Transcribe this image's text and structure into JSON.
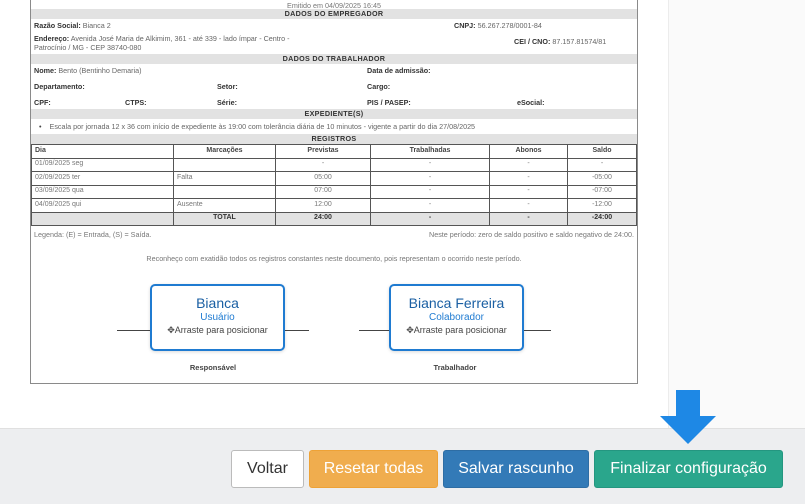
{
  "document": {
    "emitted": "Emitido em 04/09/2025 16:45",
    "sections": {
      "employer": "DADOS DO EMPREGADOR",
      "worker": "DADOS DO TRABALHADOR",
      "schedule": "EXPEDIENTE(S)",
      "records": "REGISTROS"
    },
    "employer": {
      "razao_label": "Razão Social:",
      "razao_value": "Bianca 2",
      "cnpj_label": "CNPJ:",
      "cnpj_value": "56.267.278/0001-84",
      "endereco_label": "Endereço:",
      "endereco_value": "Avenida José Maria de Alkimim, 361 - até 339 - lado ímpar - Centro -",
      "endereco_value2": "Patrocínio / MG - CEP 38740-080",
      "cei_label": "CEI / CNO:",
      "cei_value": "87.157.81574/81"
    },
    "worker": {
      "nome_label": "Nome:",
      "nome_value": "Bento (Bentinho Demaria)",
      "admissao_label": "Data de admissão:",
      "departamento_label": "Departamento:",
      "setor_label": "Setor:",
      "cargo_label": "Cargo:",
      "cpf_label": "CPF:",
      "ctps_label": "CTPS:",
      "serie_label": "Série:",
      "pis_label": "PIS / PASEP:",
      "esocial_label": "eSocial:"
    },
    "schedule_text": "Escala por jornada 12 x 36 com início de expediente às 19:00 com tolerância diária de 10 minutos - vigente a partir do dia 27/08/2025",
    "table": {
      "headers": [
        "Dia",
        "Marcações",
        "Previstas",
        "Trabalhadas",
        "Abonos",
        "Saldo"
      ],
      "rows": [
        [
          "01/09/2025 seg",
          "",
          "-",
          "-",
          "-",
          "-"
        ],
        [
          "02/09/2025 ter",
          "Falta",
          "05:00",
          "-",
          "-",
          "-05:00"
        ],
        [
          "03/09/2025 qua",
          "",
          "07:00",
          "-",
          "-",
          "-07:00"
        ],
        [
          "04/09/2025 qui",
          "Ausente",
          "12:00",
          "-",
          "-",
          "-12:00"
        ]
      ],
      "total": [
        "",
        "TOTAL",
        "24:00",
        "-",
        "-",
        "-24:00"
      ]
    },
    "legend": "Legenda: (E) = Entrada, (S) = Saída.",
    "period_note": "Neste período: zero de saldo positivo e saldo negativo de 24:00.",
    "acknowledgement": "Reconheço com exatidão todos os registros constantes neste documento, pois representam o ocorrido neste período.",
    "responsible_label": "Responsável",
    "worker_label": "Trabalhador"
  },
  "signatures": [
    {
      "name": "Bianca",
      "role": "Usuário",
      "drag_hint": "Arraste para posicionar"
    },
    {
      "name": "Bianca Ferreira",
      "role": "Colaborador",
      "drag_hint": "Arraste para posicionar"
    }
  ],
  "footer": {
    "back_label": "Voltar",
    "reset_label": "Resetar todas",
    "save_label": "Salvar rascunho",
    "finalize_label": "Finalizar configuração"
  },
  "colors": {
    "accent_blue": "#1f7bd1",
    "reset_orange": "#f0ad4e",
    "save_blue": "#337ab7",
    "finalize_green": "#2aa68c",
    "arrow_blue": "#1e88e5"
  },
  "icons": {
    "drag": "move-icon",
    "pointer": "arrow-down-icon"
  }
}
